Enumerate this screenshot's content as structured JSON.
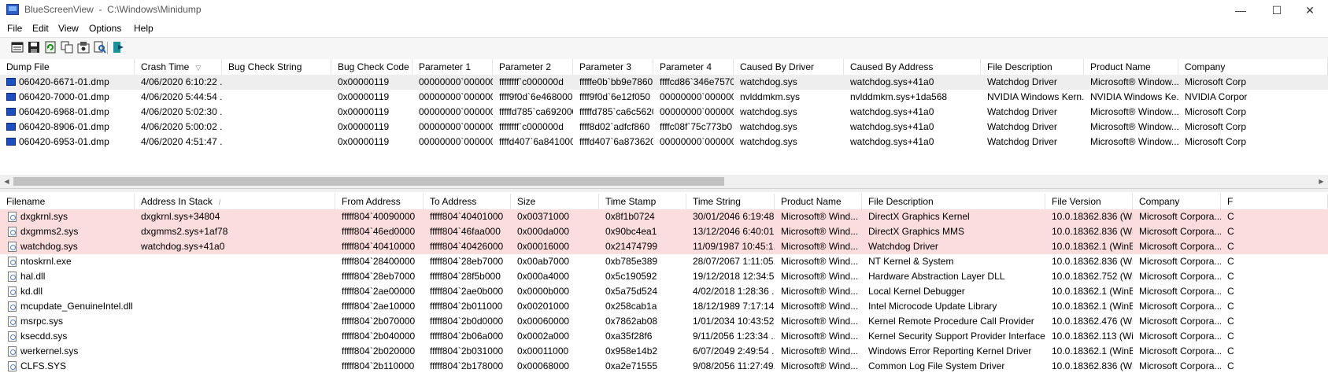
{
  "window": {
    "title": "BlueScreenView  -  C:\\Windows\\Minidump",
    "minimize_glyph": "—",
    "maximize_glyph": "☐",
    "close_glyph": "✕"
  },
  "menu": {
    "items": [
      "File",
      "Edit",
      "View",
      "Options",
      "Help"
    ]
  },
  "toolbar": {
    "buttons": [
      "properties-icon",
      "save-icon",
      "refresh-icon",
      "copy-icon",
      "advanced-options-icon",
      "find-icon",
      "exit-icon"
    ]
  },
  "colors": {
    "highlight_row": "#fbdddd",
    "selected_row": "#eeeeee",
    "dump_icon": "#1e4fc0"
  },
  "upper_table": {
    "sort_glyph": "▽",
    "columns": [
      "Dump File",
      "Crash Time",
      "Bug Check String",
      "Bug Check Code",
      "Parameter 1",
      "Parameter 2",
      "Parameter 3",
      "Parameter 4",
      "Caused By Driver",
      "Caused By Address",
      "File Description",
      "Product Name",
      "Company"
    ],
    "rows": [
      [
        "060420-6671-01.dmp",
        "4/06/2020 6:10:22 ...",
        "",
        "0x00000119",
        "00000000`000000...",
        "ffffffff`c000000d",
        "fffffe0b`bb9e7860",
        "ffffcd86`346e7570",
        "watchdog.sys",
        "watchdog.sys+41a0",
        "Watchdog Driver",
        "Microsoft® Window...",
        "Microsoft Corp"
      ],
      [
        "060420-7000-01.dmp",
        "4/06/2020 5:44:54 ...",
        "",
        "0x00000119",
        "00000000`000000...",
        "ffff9f0d`6e468000",
        "ffff9f0d`6e12f050",
        "00000000`000000...",
        "nvlddmkm.sys",
        "nvlddmkm.sys+1da568",
        "NVIDIA Windows Kern...",
        "NVIDIA Windows Ke...",
        "NVIDIA Corpor"
      ],
      [
        "060420-6968-01.dmp",
        "4/06/2020 5:02:30 ...",
        "",
        "0x00000119",
        "00000000`000000...",
        "fffffd785`ca692000",
        "fffffd785`ca6c5620",
        "00000000`000000...",
        "watchdog.sys",
        "watchdog.sys+41a0",
        "Watchdog Driver",
        "Microsoft® Window...",
        "Microsoft Corp"
      ],
      [
        "060420-8906-01.dmp",
        "4/06/2020 5:00:02 ...",
        "",
        "0x00000119",
        "00000000`000000...",
        "ffffffff`c000000d",
        "ffff8d02`adfcf860",
        "ffffc08f`75c773b0",
        "watchdog.sys",
        "watchdog.sys+41a0",
        "Watchdog Driver",
        "Microsoft® Window...",
        "Microsoft Corp"
      ],
      [
        "060420-6953-01.dmp",
        "4/06/2020 4:51:47 ...",
        "",
        "0x00000119",
        "00000000`000000...",
        "ffffd407`6a841000",
        "ffffd407`6a873620",
        "00000000`000000...",
        "watchdog.sys",
        "watchdog.sys+41a0",
        "Watchdog Driver",
        "Microsoft® Window...",
        "Microsoft Corp"
      ]
    ]
  },
  "scrollbar": {
    "left_arrow": "◀",
    "right_arrow": "▶"
  },
  "lower_table": {
    "sort_glyph": "/",
    "columns": [
      "Filename",
      "Address In Stack",
      "From Address",
      "To Address",
      "Size",
      "Time Stamp",
      "Time String",
      "Product Name",
      "File Description",
      "File Version",
      "Company",
      "F"
    ],
    "rows": [
      [
        "dxgkrnl.sys",
        "dxgkrnl.sys+34804",
        "fffff804`40090000",
        "fffff804`40401000",
        "0x00371000",
        "0x8f1b0724",
        "30/01/2046 6:19:48...",
        "Microsoft® Wind...",
        "DirectX Graphics Kernel",
        "10.0.18362.836 (Wi...",
        "Microsoft Corpora...",
        "C"
      ],
      [
        "dxgmms2.sys",
        "dxgmms2.sys+1af78",
        "fffff804`46ed0000",
        "fffff804`46faa000",
        "0x000da000",
        "0x90bc4ea1",
        "13/12/2046 6:40:01...",
        "Microsoft® Wind...",
        "DirectX Graphics MMS",
        "10.0.18362.836 (Wi...",
        "Microsoft Corpora...",
        "C"
      ],
      [
        "watchdog.sys",
        "watchdog.sys+41a0",
        "fffff804`40410000",
        "fffff804`40426000",
        "0x00016000",
        "0x21474799",
        "11/09/1987 10:45:1...",
        "Microsoft® Wind...",
        "Watchdog Driver",
        "10.0.18362.1 (WinB...",
        "Microsoft Corpora...",
        "C"
      ],
      [
        "ntoskrnl.exe",
        "",
        "fffff804`28400000",
        "fffff804`28eb7000",
        "0x00ab7000",
        "0xb785e389",
        "28/07/2067 1:11:05...",
        "Microsoft® Wind...",
        "NT Kernel & System",
        "10.0.18362.836 (Wi...",
        "Microsoft Corpora...",
        "C"
      ],
      [
        "hal.dll",
        "",
        "fffff804`28eb7000",
        "fffff804`28f5b000",
        "0x000a4000",
        "0x5c190592",
        "19/12/2018 12:34:5...",
        "Microsoft® Wind...",
        "Hardware Abstraction Layer DLL",
        "10.0.18362.752 (Wi...",
        "Microsoft Corpora...",
        "C"
      ],
      [
        "kd.dll",
        "",
        "fffff804`2ae00000",
        "fffff804`2ae0b000",
        "0x0000b000",
        "0x5a75d524",
        "4/02/2018 1:28:36 ...",
        "Microsoft® Wind...",
        "Local Kernel Debugger",
        "10.0.18362.1 (WinB...",
        "Microsoft Corpora...",
        "C"
      ],
      [
        "mcupdate_GenuineIntel.dll",
        "",
        "fffff804`2ae10000",
        "fffff804`2b011000",
        "0x00201000",
        "0x258cab1a",
        "18/12/1989 7:17:14...",
        "Microsoft® Wind...",
        "Intel Microcode Update Library",
        "10.0.18362.1 (WinB...",
        "Microsoft Corpora...",
        "C"
      ],
      [
        "msrpc.sys",
        "",
        "fffff804`2b070000",
        "fffff804`2b0d0000",
        "0x00060000",
        "0x7862ab08",
        "1/01/2034 10:43:52...",
        "Microsoft® Wind...",
        "Kernel Remote Procedure Call Provider",
        "10.0.18362.476 (Wi...",
        "Microsoft Corpora...",
        "C"
      ],
      [
        "ksecdd.sys",
        "",
        "fffff804`2b040000",
        "fffff804`2b06a000",
        "0x0002a000",
        "0xa35f28f6",
        "9/11/2056 1:23:34 ...",
        "Microsoft® Wind...",
        "Kernel Security Support Provider Interface",
        "10.0.18362.113 (Wi...",
        "Microsoft Corpora...",
        "C"
      ],
      [
        "werkernel.sys",
        "",
        "fffff804`2b020000",
        "fffff804`2b031000",
        "0x00011000",
        "0x958e14b2",
        "6/07/2049 2:49:54 ...",
        "Microsoft® Wind...",
        "Windows Error Reporting Kernel Driver",
        "10.0.18362.1 (WinB...",
        "Microsoft Corpora...",
        "C"
      ],
      [
        "CLFS.SYS",
        "",
        "fffff804`2b110000",
        "fffff804`2b178000",
        "0x00068000",
        "0xa2e71555",
        "9/08/2056 11:27:49...",
        "Microsoft® Wind...",
        "Common Log File System Driver",
        "10.0.18362.836 (Wi...",
        "Microsoft Corpora...",
        "C"
      ]
    ]
  }
}
